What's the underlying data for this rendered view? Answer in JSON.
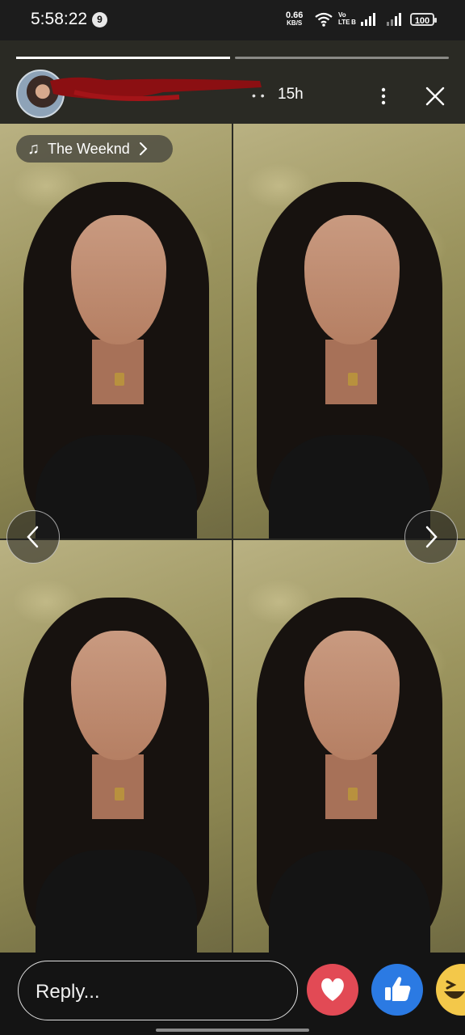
{
  "status_bar": {
    "time": "5:58:22",
    "notification_count": "9",
    "net_speed_value": "0.66",
    "net_speed_unit": "KB/S",
    "volte_top": "Vo",
    "volte_bottom": "LTE B",
    "battery": "100",
    "icons": [
      "wifi-icon",
      "signal-icon",
      "signal-icon",
      "battery-icon"
    ]
  },
  "story": {
    "progress": [
      1.0,
      0.0
    ],
    "posted_ago": "15h",
    "music_label": "The Weeknd",
    "icons": [
      "music-note-icon",
      "chevron-right-icon",
      "more-vertical-icon",
      "close-icon",
      "arrow-left-icon",
      "arrow-right-icon"
    ]
  },
  "reply_bar": {
    "placeholder": "Reply...",
    "reactions": [
      "heart-reaction",
      "like-reaction",
      "haha-reaction"
    ],
    "colors": {
      "heart": "#e24a55",
      "like": "#2b7ae3",
      "haha": "#f3c84a"
    }
  }
}
